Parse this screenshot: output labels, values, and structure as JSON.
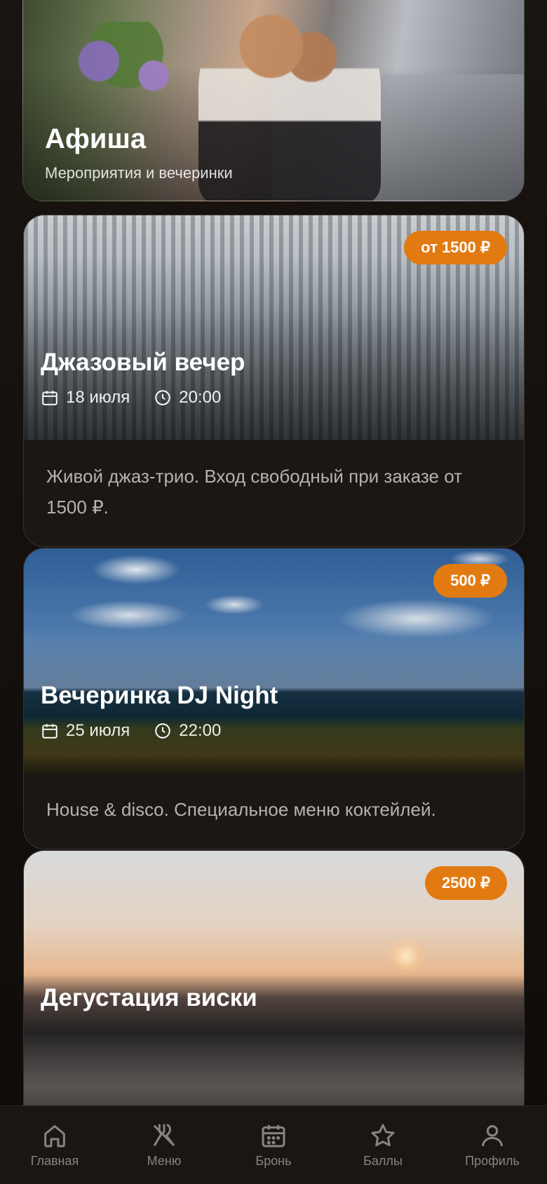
{
  "hero": {
    "title": "Афиша",
    "subtitle": "Мероприятия и вечеринки"
  },
  "events": [
    {
      "title": "Джазовый вечер",
      "date": "18 июля",
      "time": "20:00",
      "price": "от 1500 ₽",
      "description": "Живой джаз-трио. Вход свободный при заказе от 1500 ₽.",
      "image": "snowy-forest"
    },
    {
      "title": "Вечеринка DJ Night",
      "date": "25 июля",
      "time": "22:00",
      "price": "500 ₽",
      "description": "House & disco. Специальное меню коктейлей.",
      "image": "sea-coast"
    },
    {
      "title": "Дегустация виски",
      "price": "2500 ₽",
      "image": "sunset-mountains"
    }
  ],
  "nav": {
    "items": [
      {
        "label": "Главная",
        "icon": "home-icon"
      },
      {
        "label": "Меню",
        "icon": "cutlery-icon"
      },
      {
        "label": "Бронь",
        "icon": "calendar-icon"
      },
      {
        "label": "Баллы",
        "icon": "star-icon"
      },
      {
        "label": "Профиль",
        "icon": "user-icon"
      }
    ]
  },
  "colors": {
    "accent": "#e27a12",
    "background": "#110e0c",
    "card": "#1b1715",
    "muted_text": "#b9b1ab",
    "nav_text": "#8b837d"
  }
}
